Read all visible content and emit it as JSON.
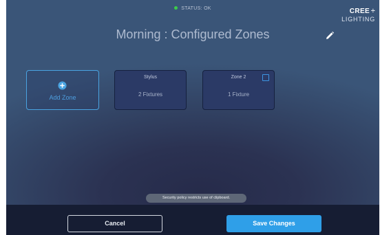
{
  "status": {
    "text": "STATUS: OK",
    "dot_color": "#3ccc4a"
  },
  "brand": {
    "name": "CREE",
    "mark": "÷",
    "sub": "LIGHTING"
  },
  "title": "Morning  : Configured Zones",
  "edit_icon": "pencil-icon",
  "add_zone": {
    "label": "Add Zone",
    "icon": "plus-circle-icon",
    "accent": "#4aa4e2"
  },
  "zones": [
    {
      "name": "Stylus",
      "count": "2 Fixtures",
      "checkbox": false
    },
    {
      "name": "Zone 2",
      "count": "1 Fixture",
      "checkbox": true
    }
  ],
  "toast": "Security policy restricts use of clipboard.",
  "footer": {
    "cancel_label": "Cancel",
    "save_label": "Save Changes",
    "save_color": "#2f9fe8"
  }
}
